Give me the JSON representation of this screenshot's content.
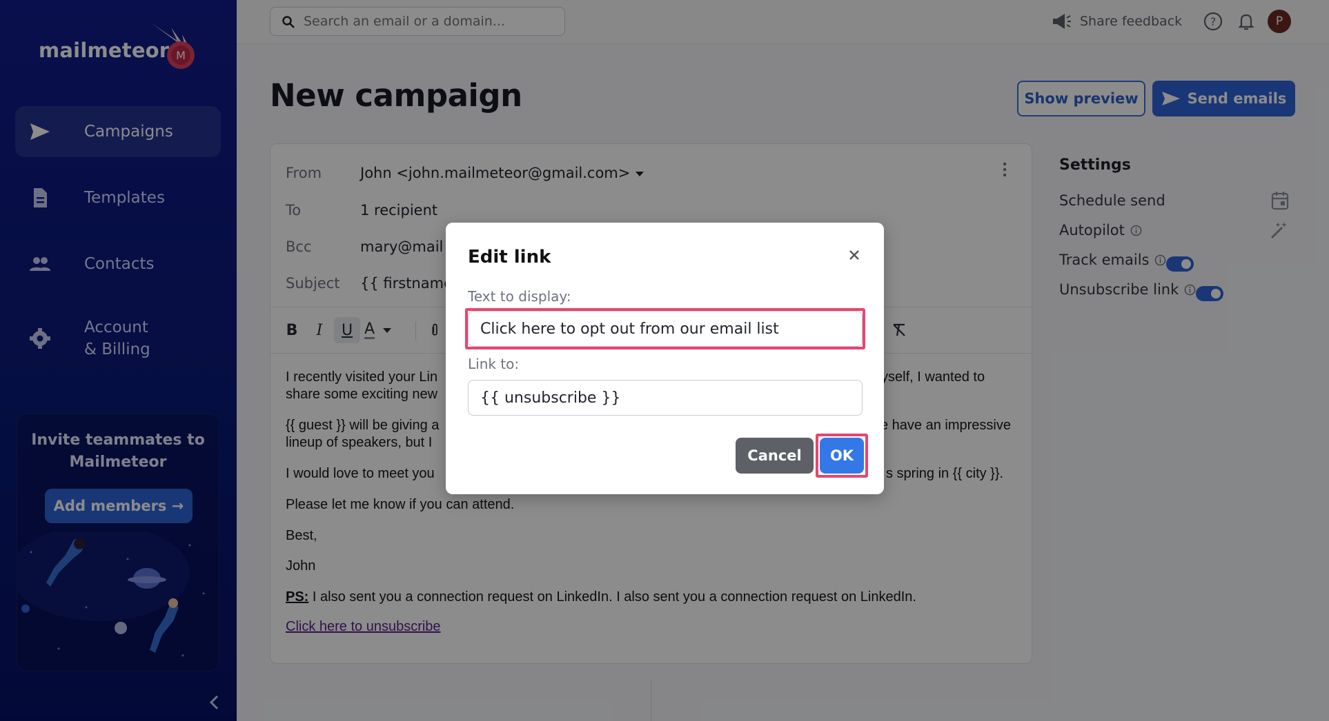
{
  "app": {
    "name": "mailmeteor"
  },
  "sidebar": {
    "items": [
      {
        "label": "Campaigns",
        "icon": "send-icon",
        "active": true
      },
      {
        "label": "Templates",
        "icon": "document-icon",
        "active": false
      },
      {
        "label": "Contacts",
        "icon": "people-icon",
        "active": false
      },
      {
        "label_line1": "Account",
        "label_line2": "& Billing",
        "icon": "gear-icon",
        "active": false
      }
    ],
    "invite": {
      "title_line1": "Invite teammates to",
      "title_line2": "Mailmeteor",
      "button": "Add members →"
    }
  },
  "topbar": {
    "search_placeholder": "Search an email or a domain...",
    "share_feedback": "Share feedback",
    "avatar_initial": "P"
  },
  "page": {
    "title": "New campaign",
    "show_preview": "Show preview",
    "send_emails": "Send emails"
  },
  "editor": {
    "from_label": "From",
    "from_value": "John <john.mailmeteor@gmail.com>",
    "to_label": "To",
    "to_value": "1 recipient",
    "bcc_label": "Bcc",
    "bcc_value": "mary@mail",
    "subject_label": "Subject",
    "subject_value": "{{ firstname",
    "toolbar": {
      "bold": "B",
      "italic": "I",
      "underline": "U",
      "text_color": "A"
    },
    "body": {
      "p1_left_line1": "I recently visited your Lin",
      "p1_left_line2": "share some exciting new",
      "p1_right_line1": "yself, I wanted to",
      "p2_left_line1": "{{ guest }} will be giving a",
      "p2_left_line2": "lineup of speakers, but I",
      "p2_right_line1": "e have an impressive",
      "p3_left": "I would love to meet you",
      "p3_right": "s spring in {{ city }}.",
      "p4": "Please let me know if you can attend.",
      "p5": "Best,",
      "p6": "John",
      "ps_label": "PS:",
      "ps_text": " I also sent you a connection request on LinkedIn. I also sent you a connection request on LinkedIn.",
      "unsubscribe_link": "Click here to unsubscribe"
    }
  },
  "settings": {
    "title": "Settings",
    "rows": [
      {
        "label": "Schedule send",
        "control": "calendar-icon"
      },
      {
        "label": "Autopilot",
        "control": "magic-wand-icon"
      },
      {
        "label": "Track emails",
        "control": "toggle",
        "enabled": true
      },
      {
        "label": "Unsubscribe link",
        "control": "toggle",
        "enabled": true
      }
    ]
  },
  "modal": {
    "title": "Edit link",
    "text_label": "Text to display:",
    "text_value": "Click here to opt out from our email list",
    "link_label": "Link to:",
    "link_value": "{{ unsubscribe }}",
    "cancel": "Cancel",
    "ok": "OK"
  },
  "colors": {
    "sidebar_bg": "#0d1a80",
    "primary": "#2f63d8",
    "highlight": "#e8456f",
    "ok_button": "#3478e8",
    "cancel_button": "#5d6067"
  }
}
